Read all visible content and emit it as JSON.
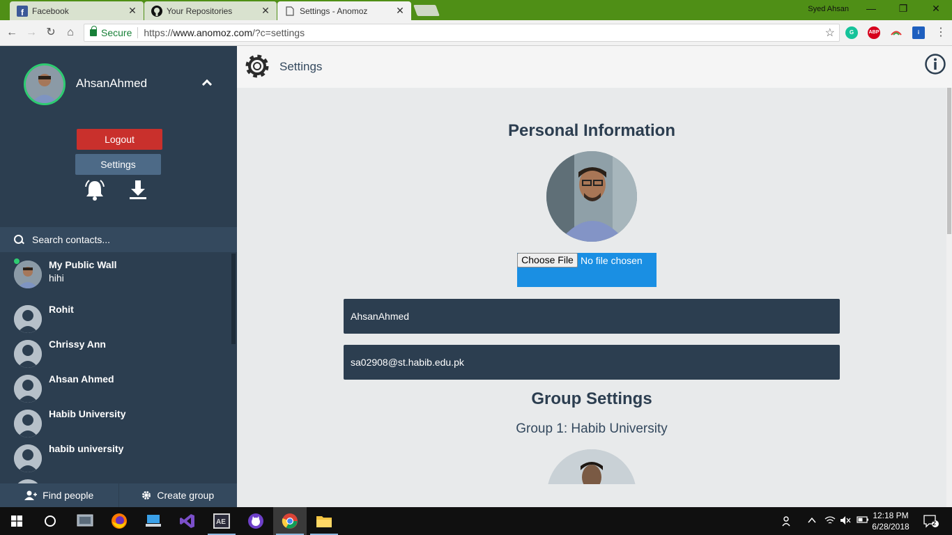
{
  "browser": {
    "tabs": [
      {
        "title": "Facebook",
        "icon": "facebook-icon",
        "active": false
      },
      {
        "title": "Your Repositories",
        "icon": "github-icon",
        "active": false
      },
      {
        "title": "Settings - Anomoz",
        "icon": "page-icon",
        "active": true
      }
    ],
    "user": "Syed Ahsan",
    "secure_label": "Secure",
    "url_scheme": "https://",
    "url_host": "www.anomoz.com",
    "url_path": "/?c=settings",
    "extensions": [
      "grammarly-icon",
      "adblock-plus-icon",
      "colorful-extension-icon",
      "blue-extension-icon"
    ]
  },
  "sidebar": {
    "username": "AhsanAhmed",
    "logout_label": "Logout",
    "settings_label": "Settings",
    "search_placeholder": "Search contacts...",
    "contacts": [
      {
        "name": "My Public Wall",
        "sub": "hihi",
        "online": true
      },
      {
        "name": "Rohit",
        "sub": ""
      },
      {
        "name": "Chrissy Ann",
        "sub": ""
      },
      {
        "name": "Ahsan Ahmed",
        "sub": ""
      },
      {
        "name": "Habib University",
        "sub": ""
      },
      {
        "name": "habib university",
        "sub": ""
      }
    ],
    "find_people_label": "Find people",
    "create_group_label": "Create group"
  },
  "main": {
    "header_title": "Settings",
    "personal_title": "Personal Information",
    "choose_file_label": "Choose File",
    "file_status": "No file chosen",
    "username_value": "AhsanAhmed",
    "email_value": "sa02908@st.habib.edu.pk",
    "group_title": "Group Settings",
    "group_1_label": "Group 1: Habib University"
  },
  "taskbar": {
    "time": "12:18 PM",
    "date": "6/28/2018",
    "notification_count": "2",
    "apps": [
      "start-icon",
      "cortana-icon",
      "file-viewer-icon",
      "firefox-icon",
      "display-icon",
      "visual-studio-icon",
      "after-effects-icon",
      "github-desktop-icon",
      "chrome-icon",
      "file-explorer-icon"
    ]
  },
  "colors": {
    "sidebar_bg": "#2c3e50",
    "logout": "#c9302c",
    "file_box": "#1a8fe3",
    "online": "#2ecc71",
    "chrome_frame": "#4f8f16"
  }
}
